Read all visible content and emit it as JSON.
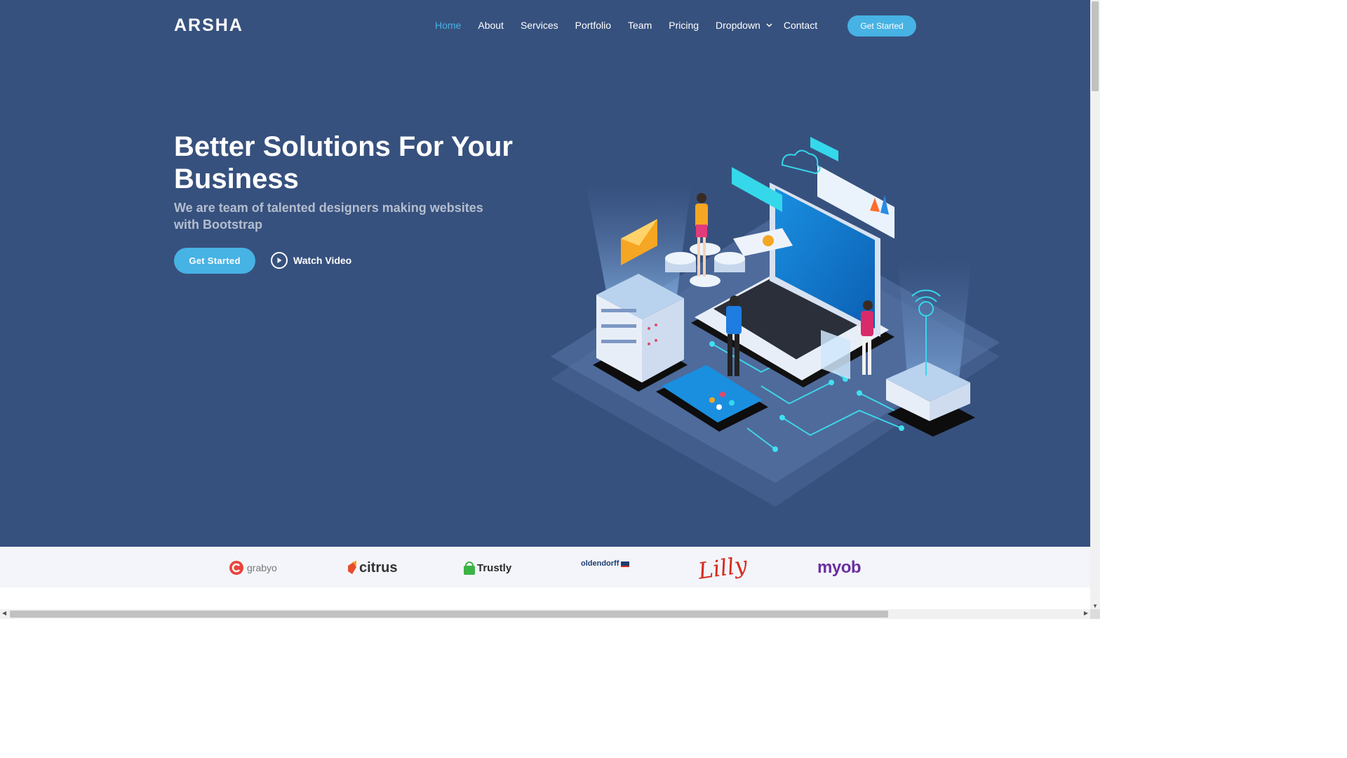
{
  "brand": {
    "logo": "ARSHA"
  },
  "nav": {
    "items": [
      {
        "label": "Home",
        "active": true
      },
      {
        "label": "About"
      },
      {
        "label": "Services"
      },
      {
        "label": "Portfolio"
      },
      {
        "label": "Team"
      },
      {
        "label": "Pricing"
      },
      {
        "label": "Dropdown",
        "icon": "chevron-down-icon"
      },
      {
        "label": "Contact"
      }
    ],
    "cta": "Get Started"
  },
  "hero": {
    "title_line1": "Better Solutions For Your",
    "title_line2": "Business",
    "subtitle": "We are team of talented designers making websites with Bootstrap",
    "primary_button": "Get Started",
    "video_button": "Watch Video",
    "video_icon": "play-circle-icon"
  },
  "clients": {
    "logos": [
      {
        "name": "grabyo",
        "color": "#e8453c"
      },
      {
        "name": "citrus",
        "color": "#333333"
      },
      {
        "name": "Trustly",
        "color": "#2a2a2a"
      },
      {
        "name": "oldendorff",
        "color": "#1c3d6e"
      },
      {
        "name": "Lilly",
        "color": "#d52b1e"
      },
      {
        "name": "myob",
        "color": "#6b2fa0"
      }
    ]
  },
  "colors": {
    "hero_bg": "#37517e",
    "accent": "#47b2e4",
    "clients_bg": "#f3f5fa"
  }
}
